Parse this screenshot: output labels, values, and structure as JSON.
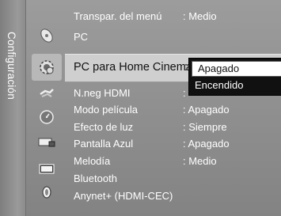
{
  "sidebar": {
    "title": "Configuración"
  },
  "icons": [
    "satellite-dish-icon",
    "gear-settings-icon",
    "input-plug-icon",
    "clock-icon",
    "keyboard-remote-icon",
    "screen-icon",
    "support-bulb-icon"
  ],
  "menu": {
    "items": [
      {
        "label": "Transpar. del menú",
        "value": ": Medio"
      },
      {
        "label": "PC",
        "value": ""
      },
      {
        "label": "PC para Home Cinema",
        "value": ":"
      },
      {
        "label": "N.neg HDMI",
        "value": ":"
      },
      {
        "label": "Modo película",
        "value": ": Apagado"
      },
      {
        "label": "Efecto de luz",
        "value": ": Siempre"
      },
      {
        "label": "Pantalla Azul",
        "value": ": Apagado"
      },
      {
        "label": "Melodía",
        "value": ": Medio"
      },
      {
        "label": "Bluetooth",
        "value": ""
      },
      {
        "label": "Anynet+ (HDMI-CEC)",
        "value": ""
      }
    ]
  },
  "dropdown": {
    "options": [
      "Apagado",
      "Encendido"
    ],
    "selected": "Apagado"
  },
  "colors": {
    "background": "#8e8e8e",
    "highlight": "#cfcfcf",
    "dropdown_bg": "#111111",
    "text": "#ffffff"
  }
}
